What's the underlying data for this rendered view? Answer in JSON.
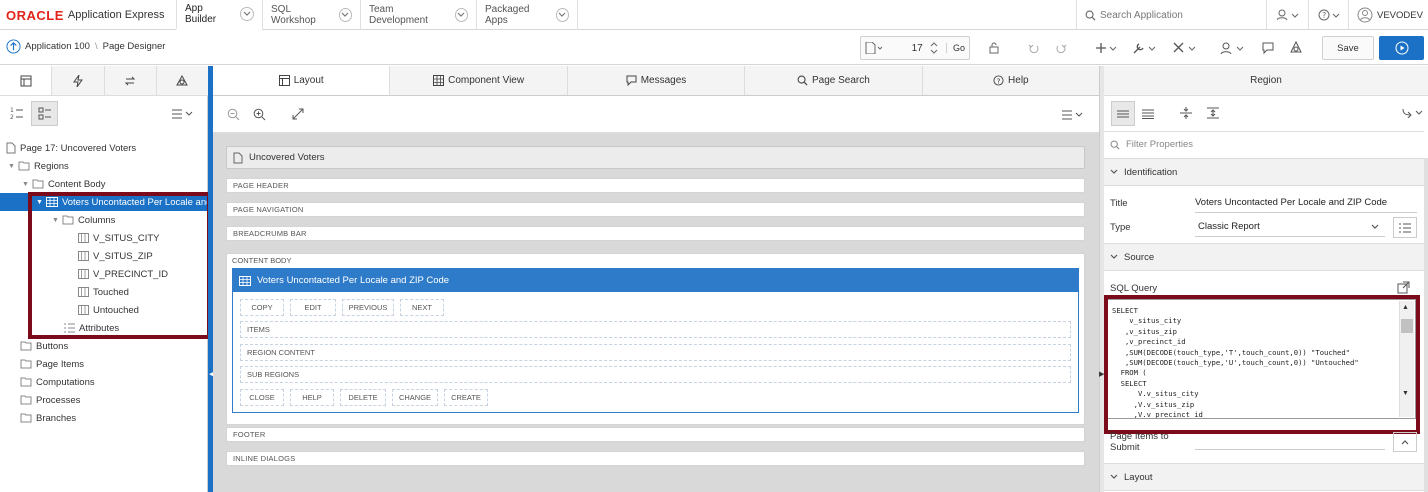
{
  "header": {
    "logo_brand": "ORACLE",
    "logo_product": "Application Express",
    "nav": [
      {
        "label": "App Builder"
      },
      {
        "label": "SQL Workshop"
      },
      {
        "label": "Team Development"
      },
      {
        "label": "Packaged Apps"
      }
    ],
    "search_placeholder": "Search Application",
    "user": "VEVODEV"
  },
  "toolbar": {
    "breadcrumb_app": "Application 100",
    "breadcrumb_page": "Page Designer",
    "page_number": "17",
    "go_label": "Go",
    "save_label": "Save"
  },
  "left_panel": {
    "tree": {
      "page": "Page 17: Uncovered Voters",
      "regions": "Regions",
      "content_body": "Content Body",
      "selected_region": "Voters Uncontacted Per Locale and",
      "columns": "Columns",
      "column_items": [
        "V_SITUS_CITY",
        "V_SITUS_ZIP",
        "V_PRECINCT_ID",
        "Touched",
        "Untouched"
      ],
      "attributes": "Attributes",
      "others": [
        "Buttons",
        "Page Items",
        "Computations",
        "Processes",
        "Branches"
      ]
    }
  },
  "center": {
    "tabs": [
      "Layout",
      "Component View",
      "Messages",
      "Page Search",
      "Help"
    ],
    "page_title": "Uncovered Voters",
    "bars_top": [
      "PAGE HEADER",
      "PAGE NAVIGATION",
      "BREADCRUMB BAR"
    ],
    "content_body_label": "CONTENT BODY",
    "region_title": "Voters Uncontacted Per Locale and ZIP Code",
    "top_buttons": [
      "COPY",
      "EDIT",
      "PREVIOUS",
      "NEXT"
    ],
    "slots": [
      "ITEMS",
      "REGION CONTENT",
      "SUB REGIONS"
    ],
    "bottom_buttons": [
      "CLOSE",
      "HELP",
      "DELETE",
      "CHANGE",
      "CREATE"
    ],
    "bars_bottom": [
      "FOOTER",
      "INLINE DIALOGS"
    ]
  },
  "right_panel": {
    "tab": "Region",
    "filter_placeholder": "Filter Properties",
    "sections": {
      "identification": "Identification",
      "source": "Source",
      "layout": "Layout"
    },
    "title_label": "Title",
    "title_value": "Voters Uncontacted Per Locale and ZIP Code",
    "type_label": "Type",
    "type_value": "Classic Report",
    "sql_label": "SQL Query",
    "sql_text": "SELECT\n    v_situs_city\n   ,v_situs_zip\n   ,v_precinct_id\n   ,SUM(DECODE(touch_type,'T',touch_count,0)) \"Touched\"\n   ,SUM(DECODE(touch_type,'U',touch_count,0)) \"Untouched\"\n  FROM (\n  SELECT\n      V.v_situs_city\n     ,V.v_situs_zip\n     ,V.v_precinct_id",
    "page_items_label_1": "Page Items to",
    "page_items_label_2": "Submit"
  },
  "colors": {
    "accent": "#1a71c5",
    "highlight": "#7b0b1b",
    "region_header": "#2e7bc9"
  }
}
